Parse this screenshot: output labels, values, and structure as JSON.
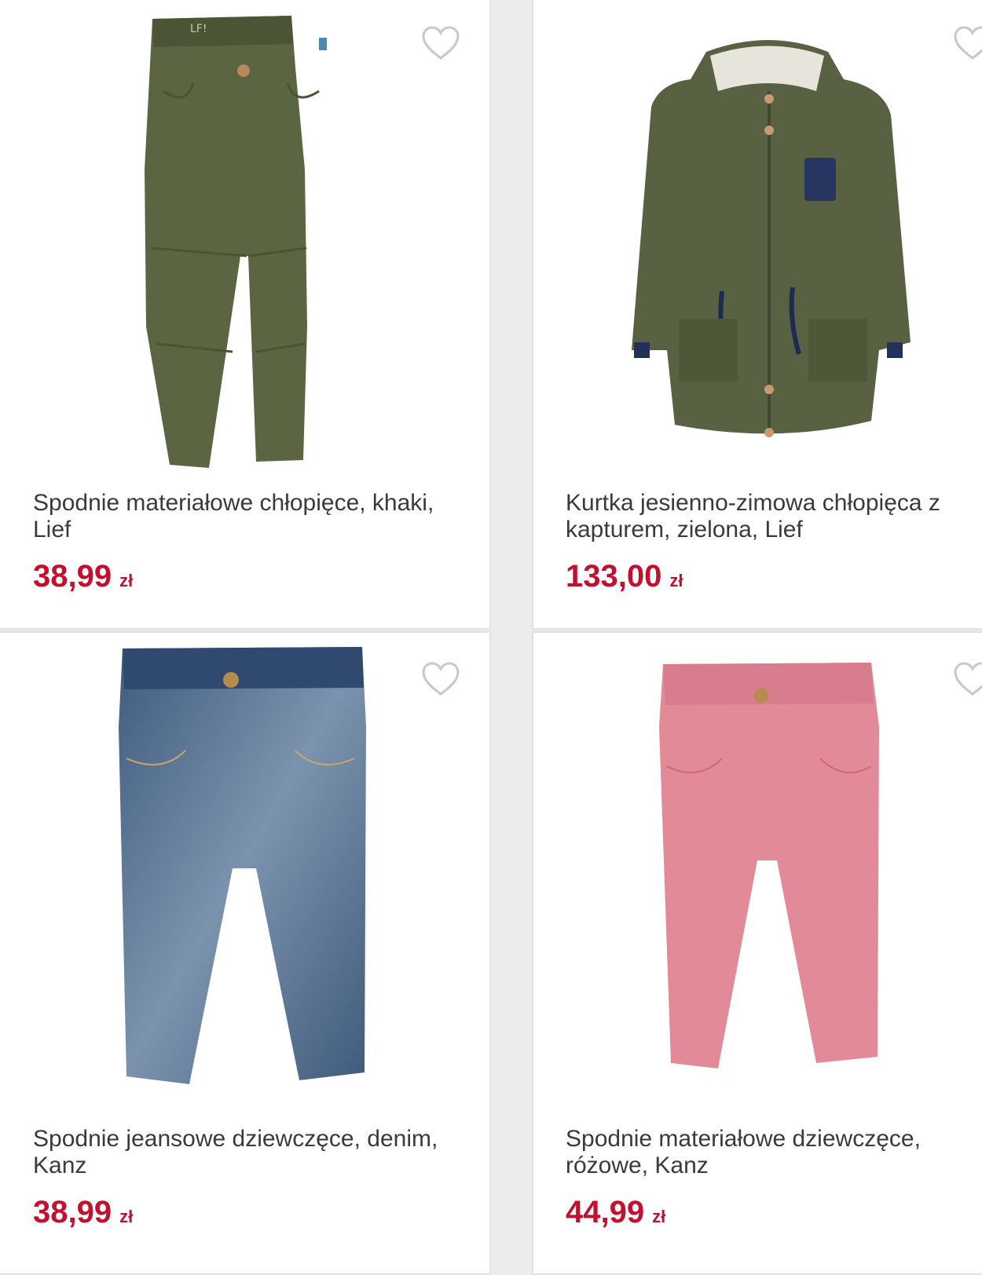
{
  "currency": "zł",
  "colors": {
    "price": "#c4102e",
    "title": "#3a3a3a",
    "card_border": "#e2e2e2"
  },
  "products": [
    {
      "title": "Spodnie materiałowe chłopięce, khaki, Lief",
      "price": "38,99",
      "favorite_icon": "heart-outline-icon",
      "image": "khaki-pants"
    },
    {
      "title": "Kurtka jesienno-zimowa chłopięca z kapturem, zielona, Lief",
      "price": "133,00",
      "favorite_icon": "heart-outline-icon",
      "image": "green-jacket"
    },
    {
      "title": "Spodnie jeansowe dziewczęce, denim, Kanz",
      "price": "38,99",
      "favorite_icon": "heart-outline-icon",
      "image": "denim-jeans"
    },
    {
      "title": "Spodnie materiałowe dziewczęce, różowe, Kanz",
      "price": "44,99",
      "favorite_icon": "heart-outline-icon",
      "image": "pink-pants"
    }
  ]
}
